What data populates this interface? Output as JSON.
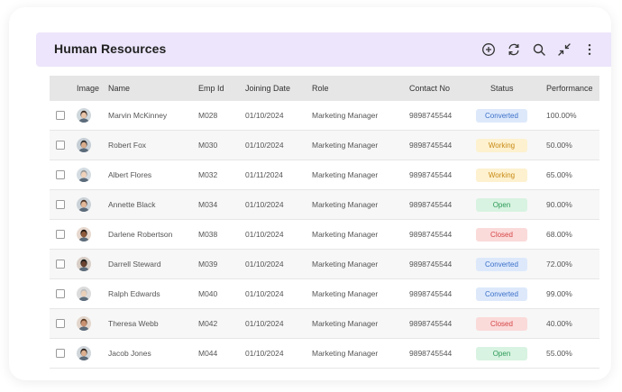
{
  "header": {
    "title": "Human Resources",
    "icons": [
      "add-circle-icon",
      "refresh-icon",
      "search-icon",
      "collapse-icon",
      "more-vertical-icon"
    ]
  },
  "table": {
    "columns": {
      "image": "Image",
      "name": "Name",
      "emp_id": "Emp Id",
      "joining_date": "Joining Date",
      "role": "Role",
      "contact_no": "Contact No",
      "status": "Status",
      "performance": "Performance"
    },
    "rows": [
      {
        "name": "Marvin McKinney",
        "emp_id": "M028",
        "joining_date": "01/10/2024",
        "role": "Marketing Manager",
        "contact_no": "9898745544",
        "status": "Converted",
        "performance": "100.00%"
      },
      {
        "name": "Robert Fox",
        "emp_id": "M030",
        "joining_date": "01/10/2024",
        "role": "Marketing Manager",
        "contact_no": "9898745544",
        "status": "Working",
        "performance": "50.00%"
      },
      {
        "name": "Albert Flores",
        "emp_id": "M032",
        "joining_date": "01/11/2024",
        "role": "Marketing Manager",
        "contact_no": "9898745544",
        "status": "Working",
        "performance": "65.00%"
      },
      {
        "name": "Annette Black",
        "emp_id": "M034",
        "joining_date": "01/10/2024",
        "role": "Marketing Manager",
        "contact_no": "9898745544",
        "status": "Open",
        "performance": "90.00%"
      },
      {
        "name": "Darlene Robertson",
        "emp_id": "M038",
        "joining_date": "01/10/2024",
        "role": "Marketing Manager",
        "contact_no": "9898745544",
        "status": "Closed",
        "performance": "68.00%"
      },
      {
        "name": "Darrell Steward",
        "emp_id": "M039",
        "joining_date": "01/10/2024",
        "role": "Marketing Manager",
        "contact_no": "9898745544",
        "status": "Converted",
        "performance": "72.00%"
      },
      {
        "name": "Ralph Edwards",
        "emp_id": "M040",
        "joining_date": "01/10/2024",
        "role": "Marketing Manager",
        "contact_no": "9898745544",
        "status": "Converted",
        "performance": "99.00%"
      },
      {
        "name": "Theresa Webb",
        "emp_id": "M042",
        "joining_date": "01/10/2024",
        "role": "Marketing Manager",
        "contact_no": "9898745544",
        "status": "Closed",
        "performance": "40.00%"
      },
      {
        "name": "Jacob Jones",
        "emp_id": "M044",
        "joining_date": "01/10/2024",
        "role": "Marketing Manager",
        "contact_no": "9898745544",
        "status": "Open",
        "performance": "55.00%"
      }
    ]
  },
  "status_colors": {
    "Converted": {
      "bg": "#dde9fb",
      "fg": "#3b6fc9"
    },
    "Working": {
      "bg": "#fdf1cf",
      "fg": "#c98a14"
    },
    "Open": {
      "bg": "#d8f3e1",
      "fg": "#2b9a57"
    },
    "Closed": {
      "bg": "#fbdada",
      "fg": "#d64545"
    }
  },
  "colors": {
    "header_bg": "#ece5fb",
    "table_header_bg": "#e6e6e6"
  }
}
